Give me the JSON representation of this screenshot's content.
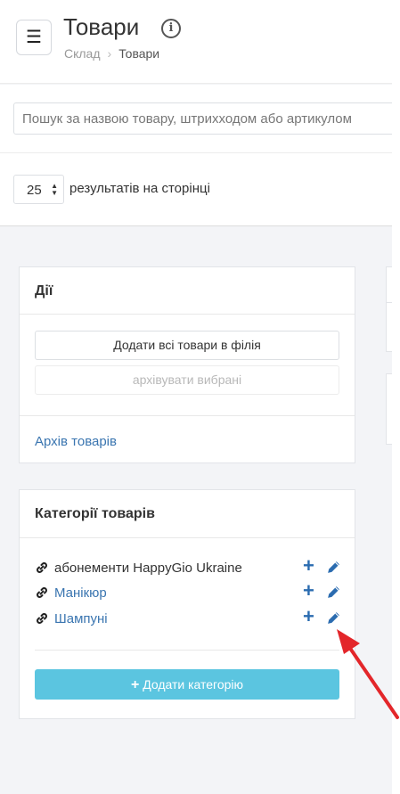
{
  "header": {
    "menu_icon": "hamburger-icon",
    "title": "Товари",
    "info_icon": "info-icon",
    "breadcrumb": [
      "Склад",
      "Товари"
    ]
  },
  "search": {
    "placeholder": "Пошук за назвою товару, штрихходом або артикулом"
  },
  "pagination": {
    "per_page": "25",
    "label": "результатів на сторінці"
  },
  "actions_panel": {
    "title": "Дії",
    "add_all_label": "Додати всі товари в філія",
    "archive_selected_label": "архівувати вибрані",
    "archive_link": "Архів товарів"
  },
  "categories_panel": {
    "title": "Категорії товарів",
    "items": [
      {
        "label": "абонементи HappyGio Ukraine",
        "is_link": false
      },
      {
        "label": "Манікюр",
        "is_link": true
      },
      {
        "label": "Шампуні",
        "is_link": true
      }
    ],
    "add_button_label": "Додати категорію"
  },
  "colors": {
    "primary_blue": "#2b6cb0",
    "link_blue": "#3a75b0",
    "add_button": "#5bc5e0",
    "arrow": "#e3262a"
  }
}
